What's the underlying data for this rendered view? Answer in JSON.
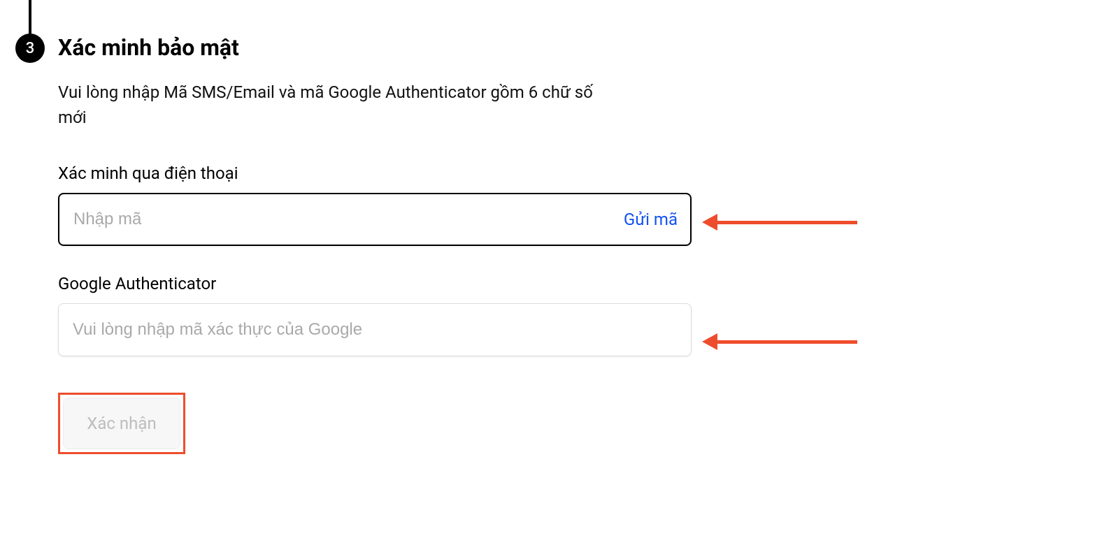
{
  "step": {
    "number": "3",
    "title": "Xác minh bảo mật",
    "description": "Vui lòng nhập Mã SMS/Email và mã Google Authenticator gồm 6 chữ số mới"
  },
  "phone": {
    "label": "Xác minh qua điện thoại",
    "placeholder": "Nhập mã",
    "send_label": "Gửi mã"
  },
  "ga": {
    "label": "Google Authenticator",
    "placeholder": "Vui lòng nhập mã xác thực của Google"
  },
  "submit": {
    "label": "Xác nhận"
  },
  "annotation": {
    "arrow_color": "#ee4d2d"
  }
}
